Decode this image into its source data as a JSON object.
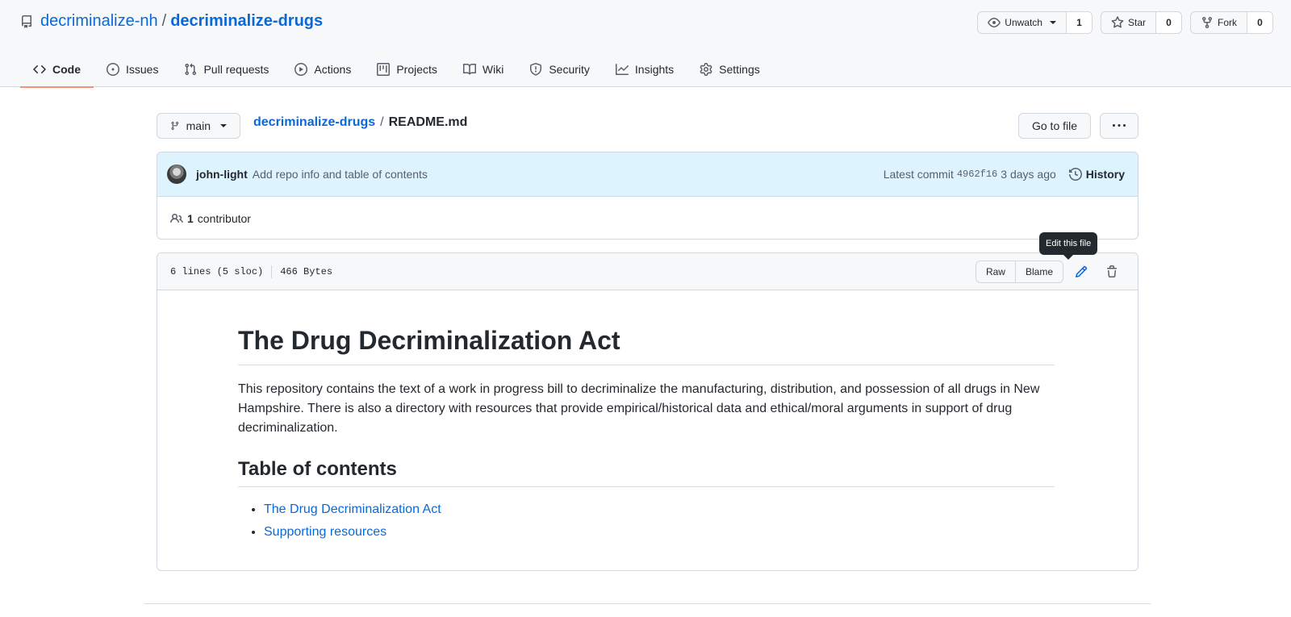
{
  "repo": {
    "owner": "decriminalize-nh",
    "separator": "/",
    "name": "decriminalize-drugs"
  },
  "actions": {
    "watch": {
      "label": "Unwatch",
      "count": "1"
    },
    "star": {
      "label": "Star",
      "count": "0"
    },
    "fork": {
      "label": "Fork",
      "count": "0"
    }
  },
  "nav": {
    "tabs": [
      {
        "label": "Code",
        "icon": "code-icon",
        "selected": true
      },
      {
        "label": "Issues",
        "icon": "issue-opened-icon"
      },
      {
        "label": "Pull requests",
        "icon": "git-pull-request-icon"
      },
      {
        "label": "Actions",
        "icon": "play-icon"
      },
      {
        "label": "Projects",
        "icon": "project-icon"
      },
      {
        "label": "Wiki",
        "icon": "book-icon"
      },
      {
        "label": "Security",
        "icon": "shield-icon"
      },
      {
        "label": "Insights",
        "icon": "graph-icon"
      },
      {
        "label": "Settings",
        "icon": "gear-icon"
      }
    ]
  },
  "file_nav": {
    "branch": "main",
    "breadcrumb_repo": "decriminalize-drugs",
    "breadcrumb_sep": "/",
    "breadcrumb_file": "README.md",
    "go_to_file": "Go to file"
  },
  "commit": {
    "author": "john-light",
    "message": "Add repo info and table of contents",
    "latest_label": "Latest commit",
    "sha": "4962f16",
    "time": "3 days ago",
    "history_label": "History"
  },
  "contributors": {
    "count": "1",
    "label": "contributor"
  },
  "file": {
    "lines": "6 lines (5 sloc)",
    "size": "466 Bytes",
    "raw_label": "Raw",
    "blame_label": "Blame",
    "tooltip": "Edit this file"
  },
  "readme": {
    "title": "The Drug Decriminalization Act",
    "intro": "This repository contains the text of a work in progress bill to decriminalize the manufacturing, distribution, and possession of all drugs in New Hampshire. There is also a directory with resources that provide empirical/historical data and ethical/moral arguments in support of drug decriminalization.",
    "toc_heading": "Table of contents",
    "toc": [
      "The Drug Decriminalization Act",
      "Supporting resources"
    ]
  },
  "colors": {
    "link": "#0969da",
    "selected_tab_underline": "#fd8c73",
    "commit_bg": "#ddf4ff"
  }
}
